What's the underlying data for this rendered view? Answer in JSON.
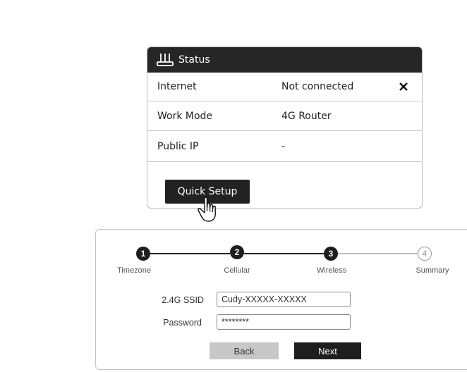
{
  "status_panel": {
    "title": "Status",
    "rows": [
      {
        "key": "Internet",
        "value": "Not connected"
      },
      {
        "key": "Work Mode",
        "value": "4G Router"
      },
      {
        "key": "Public IP",
        "value": "-"
      }
    ],
    "quick_setup_label": "Quick Setup"
  },
  "wizard": {
    "steps": [
      {
        "number": "1",
        "label": "Timezone",
        "state": "done"
      },
      {
        "number": "2",
        "label": "Cellular",
        "state": "done"
      },
      {
        "number": "3",
        "label": "Wireless",
        "state": "current"
      },
      {
        "number": "4",
        "label": "Summary",
        "state": "todo"
      }
    ],
    "ssid_label": "2.4G SSID",
    "ssid_value": "Cudy-XXXXX-XXXXX",
    "password_label": "Password",
    "password_value": "********",
    "back_label": "Back",
    "next_label": "Next"
  },
  "colors": {
    "dark": "#222222",
    "header_bg": "#262626",
    "back_button": "#c8c8c8",
    "inactive_line": "#bdbdbd"
  },
  "icons": {
    "header": "router-icon",
    "status_x": "close-icon",
    "pointer": "hand-cursor-icon"
  }
}
